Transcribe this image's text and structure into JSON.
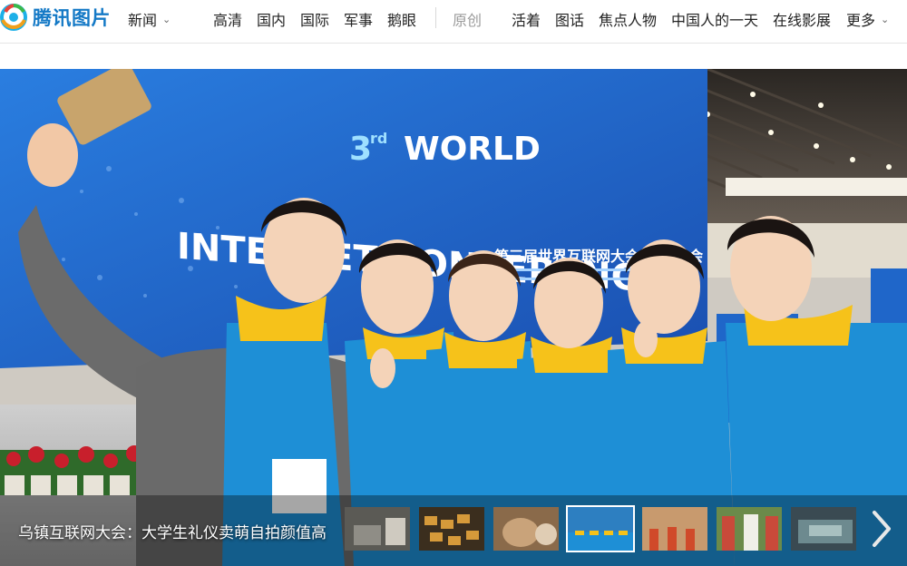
{
  "header": {
    "logo_text": "腾讯图片",
    "channel": "新闻",
    "nav_items": [
      "高清",
      "国内",
      "国际",
      "军事",
      "鹅眼"
    ],
    "original_label": "原创",
    "nav_items2": [
      "活着",
      "图话",
      "焦点人物",
      "中国人的一天",
      "在线影展"
    ],
    "more_label": "更多"
  },
  "hero": {
    "caption": "乌镇互联网大会：大学生礼仪卖萌自拍颜值高",
    "banner_en_sup": "3",
    "banner_en_sup_rd": "rd",
    "banner_en_line1": "WORLD",
    "banner_en_line2": "INTERNET CONFERENCE",
    "banner_cn": "第三届世界互联网大会·乌镇峰会"
  },
  "thumbnails": {
    "count": 8,
    "active_index": 3,
    "colors": [
      "#5b5a55",
      "#3b2e1e",
      "#8a6a4a",
      "#2d7fc1",
      "#c89a6e",
      "#c94a3a",
      "#3a4a52"
    ]
  },
  "colors": {
    "brand_blue": "#1479c6",
    "uniform_blue": "#1e8fd6",
    "uniform_yellow": "#f6c21a",
    "screen_blue": "#1d63c9"
  },
  "icons": {
    "logo": "tencent-logo-icon",
    "next": "chevron-right-icon"
  }
}
